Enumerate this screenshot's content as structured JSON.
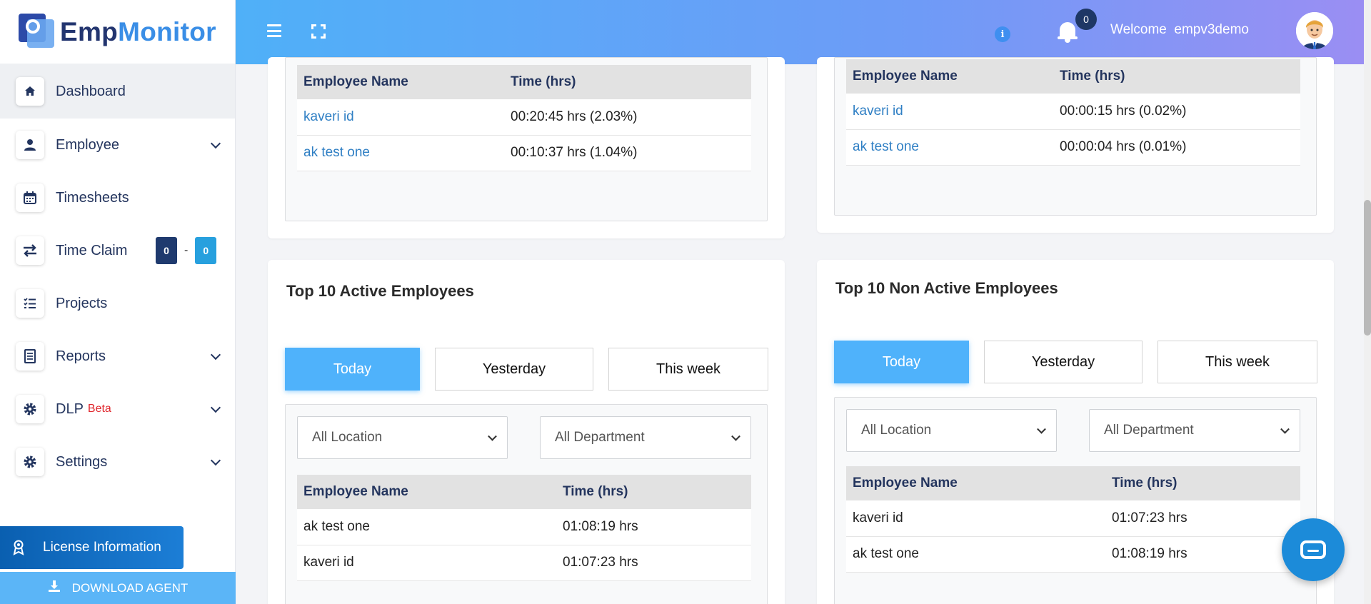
{
  "app": {
    "name_part1": "Emp",
    "name_part2": "Monitor"
  },
  "sidebar": {
    "items": [
      {
        "label": "Dashboard"
      },
      {
        "label": "Employee"
      },
      {
        "label": "Timesheets"
      },
      {
        "label": "Time Claim"
      },
      {
        "label": "Projects"
      },
      {
        "label": "Reports"
      },
      {
        "label": "DLP",
        "badge": "Beta"
      },
      {
        "label": "Settings"
      }
    ],
    "time_claim_counts": {
      "left": "0",
      "separator": "-",
      "right": "0"
    },
    "license_label": "License Information",
    "download_label": "DOWNLOAD AGENT"
  },
  "header": {
    "notification_count": "0",
    "welcome_label": "Welcome",
    "username": "empv3demo"
  },
  "top_left_card": {
    "columns": [
      "Employee Name",
      "Time (hrs)"
    ],
    "rows": [
      {
        "name": "kaveri id",
        "time": "00:20:45 hrs (2.03%)"
      },
      {
        "name": "ak test one",
        "time": "00:10:37 hrs (1.04%)"
      }
    ]
  },
  "top_right_card": {
    "columns": [
      "Employee Name",
      "Time (hrs)"
    ],
    "rows": [
      {
        "name": "kaveri id",
        "time": "00:00:15 hrs (0.02%)"
      },
      {
        "name": "ak test one",
        "time": "00:00:04 hrs (0.01%)"
      }
    ]
  },
  "active_card": {
    "title": "Top 10 Active Employees",
    "tabs": [
      "Today",
      "Yesterday",
      "This week"
    ],
    "location_select": "All Location",
    "department_select": "All Department",
    "columns": [
      "Employee Name",
      "Time (hrs)"
    ],
    "rows": [
      {
        "name": "ak test one",
        "time": "01:08:19 hrs"
      },
      {
        "name": "kaveri id",
        "time": "01:07:23 hrs"
      }
    ]
  },
  "non_active_card": {
    "title": "Top 10 Non Active Employees",
    "tabs": [
      "Today",
      "Yesterday",
      "This week"
    ],
    "location_select": "All Location",
    "department_select": "All Department",
    "columns": [
      "Employee Name",
      "Time (hrs)"
    ],
    "rows": [
      {
        "name": "kaveri id",
        "time": "01:07:23 hrs"
      },
      {
        "name": "ak test one",
        "time": "01:08:19 hrs"
      }
    ]
  },
  "colors": {
    "accent": "#4fb2fb",
    "navy": "#24355e",
    "link": "#2f7fc4"
  }
}
